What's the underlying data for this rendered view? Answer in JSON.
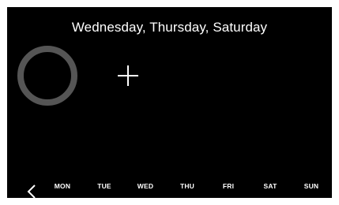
{
  "header": {
    "title": "Wednesday, Thursday, Saturday"
  },
  "ring": {
    "icon": "progress-ring",
    "color": "#555555"
  },
  "add": {
    "icon": "plus-icon"
  },
  "nav": {
    "back_icon": "chevron-left-icon"
  },
  "days": [
    {
      "label": "MON",
      "selected": false
    },
    {
      "label": "TUE",
      "selected": false
    },
    {
      "label": "WED",
      "selected": false
    },
    {
      "label": "THU",
      "selected": true
    },
    {
      "label": "FRI",
      "selected": true
    },
    {
      "label": "SAT",
      "selected": true
    },
    {
      "label": "SUN",
      "selected": false
    }
  ],
  "colors": {
    "background": "#000000",
    "text": "#ffffff",
    "selected": "#f39a2b",
    "unselected": "#7f7f7f"
  }
}
